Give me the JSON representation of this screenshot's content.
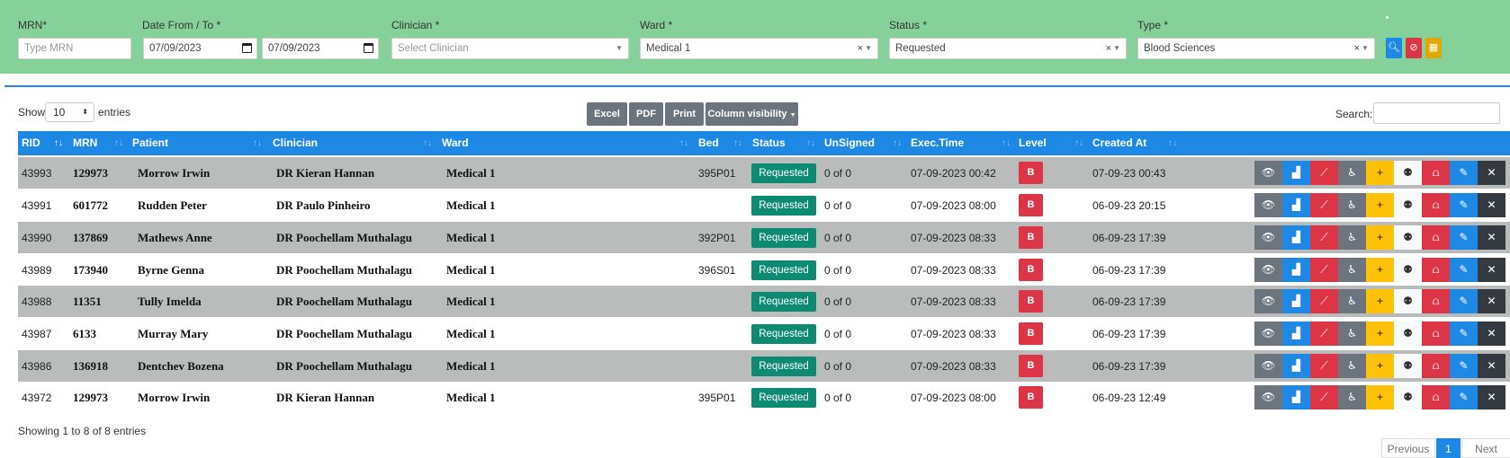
{
  "filters": {
    "mrn": {
      "label": "MRN*",
      "placeholder": "Type MRN"
    },
    "date": {
      "label": "Date From / To *",
      "from": "07/09/2023",
      "to": "07/09/2023"
    },
    "clinician": {
      "label": "Clinician *",
      "placeholder": "Select Clinician"
    },
    "ward": {
      "label": "Ward *",
      "value": "Medical 1"
    },
    "status": {
      "label": "Status *",
      "value": "Requested"
    },
    "type": {
      "label": "Type *",
      "value": "Blood Sciences"
    },
    "buttons": [
      {
        "icon": "search-icon",
        "color": "#1e88e5"
      },
      {
        "icon": "ban-icon",
        "color": "#dc3545"
      },
      {
        "icon": "calendar-icon",
        "color": "#e0a800"
      }
    ]
  },
  "controls": {
    "show_label": "Show",
    "length_value": "10",
    "entries_label": "entries",
    "export_buttons": [
      "Excel",
      "PDF",
      "Print",
      "Column visibility"
    ],
    "search_label": "Search:"
  },
  "table": {
    "columns": [
      "RID",
      "MRN",
      "Patient",
      "Clinician",
      "Ward",
      "Bed",
      "Status",
      "UnSigned",
      "Exec.Time",
      "Level",
      "Created At"
    ],
    "rows": [
      {
        "rid": "43993",
        "mrn": "129973",
        "patient": "Morrow Irwin",
        "clinician": "DR Kieran Hannan",
        "ward": "Medical 1",
        "bed": "395P01",
        "status": "Requested",
        "unsigned": "0 of 0",
        "exec": "07-09-2023 00:42",
        "level": "B",
        "created": "07-09-23 00:43"
      },
      {
        "rid": "43991",
        "mrn": "601772",
        "patient": "Rudden Peter",
        "clinician": "DR Paulo Pinheiro",
        "ward": "Medical 1",
        "bed": "",
        "status": "Requested",
        "unsigned": "0 of 0",
        "exec": "07-09-2023 08:00",
        "level": "B",
        "created": "06-09-23 20:15"
      },
      {
        "rid": "43990",
        "mrn": "137869",
        "patient": "Mathews Anne",
        "clinician": "DR Poochellam Muthalagu",
        "ward": "Medical 1",
        "bed": "392P01",
        "status": "Requested",
        "unsigned": "0 of 0",
        "exec": "07-09-2023 08:33",
        "level": "B",
        "created": "06-09-23 17:39"
      },
      {
        "rid": "43989",
        "mrn": "173940",
        "patient": "Byrne Genna",
        "clinician": "DR Poochellam Muthalagu",
        "ward": "Medical 1",
        "bed": "396S01",
        "status": "Requested",
        "unsigned": "0 of 0",
        "exec": "07-09-2023 08:33",
        "level": "B",
        "created": "06-09-23 17:39"
      },
      {
        "rid": "43988",
        "mrn": "11351",
        "patient": "Tully Imelda",
        "clinician": "DR Poochellam Muthalagu",
        "ward": "Medical 1",
        "bed": "",
        "status": "Requested",
        "unsigned": "0 of 0",
        "exec": "07-09-2023 08:33",
        "level": "B",
        "created": "06-09-23 17:39"
      },
      {
        "rid": "43987",
        "mrn": "6133",
        "patient": "Murray Mary",
        "clinician": "DR Poochellam Muthalagu",
        "ward": "Medical 1",
        "bed": "",
        "status": "Requested",
        "unsigned": "0 of 0",
        "exec": "07-09-2023 08:33",
        "level": "B",
        "created": "06-09-23 17:39"
      },
      {
        "rid": "43986",
        "mrn": "136918",
        "patient": "Dentchev Bozena",
        "clinician": "DR Poochellam Muthalagu",
        "ward": "Medical 1",
        "bed": "",
        "status": "Requested",
        "unsigned": "0 of 0",
        "exec": "07-09-2023 08:33",
        "level": "B",
        "created": "06-09-23 17:39"
      },
      {
        "rid": "43972",
        "mrn": "129973",
        "patient": "Morrow Irwin",
        "clinician": "DR Kieran Hannan",
        "ward": "Medical 1",
        "bed": "395P01",
        "status": "Requested",
        "unsigned": "0 of 0",
        "exec": "07-09-2023 08:00",
        "level": "B",
        "created": "06-09-23 12:49"
      }
    ],
    "actions": [
      {
        "icon": "eye-icon",
        "glyph": "👁",
        "color": "#6c757d"
      },
      {
        "icon": "bar-chart-icon",
        "glyph": "▟",
        "color": "#1e88e5"
      },
      {
        "icon": "line-chart-icon",
        "glyph": "⟋",
        "color": "#dc3545"
      },
      {
        "icon": "wheelchair-icon",
        "glyph": "♿",
        "color": "#6c757d"
      },
      {
        "icon": "plus-icon",
        "glyph": "+",
        "color": "#ffc107"
      },
      {
        "icon": "users-icon",
        "glyph": "⚉",
        "color": "#f8f9fa"
      },
      {
        "icon": "tube-icon",
        "glyph": "⩍",
        "color": "#dc3545"
      },
      {
        "icon": "edit-icon",
        "glyph": "✎",
        "color": "#1e88e5"
      },
      {
        "icon": "close-icon",
        "glyph": "✕",
        "color": "#343a40"
      }
    ]
  },
  "footer": {
    "info": "Showing 1 to 8 of 8 entries",
    "pagination": [
      "Previous",
      "1",
      "Next"
    ]
  }
}
